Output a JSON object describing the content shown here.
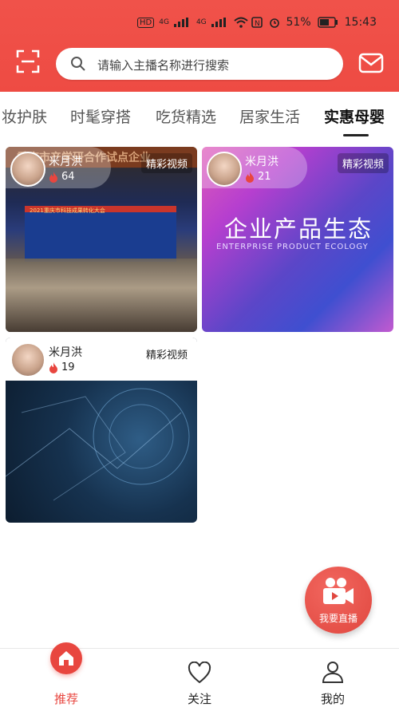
{
  "status_bar": {
    "left_text": "HD",
    "net1": "4G",
    "net2": "4G",
    "battery": "51%",
    "time": "15:43"
  },
  "search": {
    "placeholder": "请输入主播名称进行搜索"
  },
  "icons": {
    "scan": "scan-icon",
    "search": "search-icon",
    "mail": "mail-icon",
    "flame": "flame-icon",
    "home": "home-icon",
    "heart": "heart-icon",
    "user": "user-icon",
    "camera": "video-camera-icon"
  },
  "tabs": [
    {
      "label": "妆护肤"
    },
    {
      "label": "时髦穿搭"
    },
    {
      "label": "吃货精选"
    },
    {
      "label": "居家生活"
    },
    {
      "label": "实惠母婴"
    }
  ],
  "cards": [
    {
      "name": "米月洪",
      "count": "64",
      "badge": "精彩视频",
      "banner": "重庆市产学研合作试点企业",
      "stage_title": "2021重庆市科技成果转化大会"
    },
    {
      "name": "米月洪",
      "count": "21",
      "badge": "精彩视频",
      "title_cn": "企业产品生态",
      "title_en": "ENTERPRISE PRODUCT ECOLOGY"
    },
    {
      "name": "米月洪",
      "count": "19",
      "badge": "精彩视频"
    }
  ],
  "fab": {
    "label": "我要直播"
  },
  "nav": [
    {
      "label": "推荐"
    },
    {
      "label": "关注"
    },
    {
      "label": "我的"
    }
  ],
  "colors": {
    "accent": "#ee4b43",
    "fire": "#e8463f"
  }
}
